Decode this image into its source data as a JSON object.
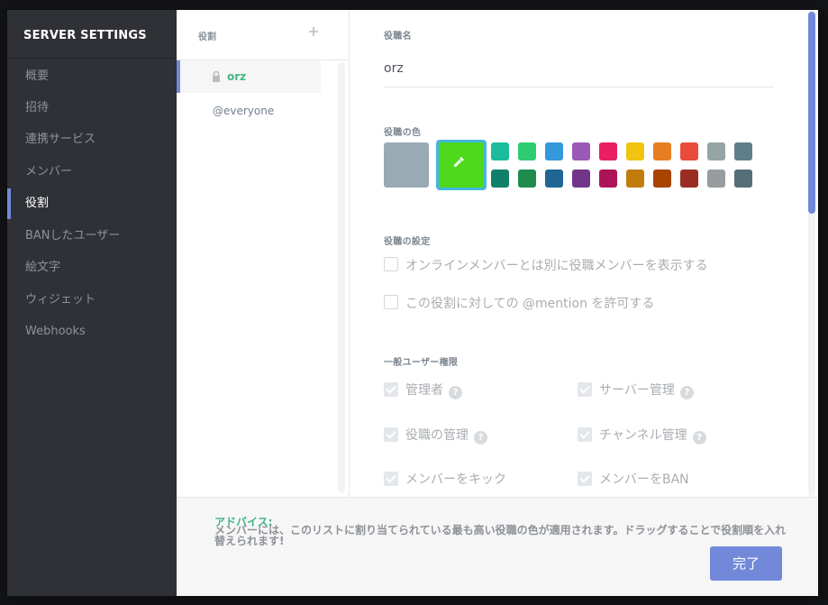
{
  "nav": {
    "title": "SERVER SETTINGS",
    "items": [
      {
        "label": "概要"
      },
      {
        "label": "招待"
      },
      {
        "label": "連携サービス"
      },
      {
        "label": "メンバー"
      },
      {
        "label": "役割"
      },
      {
        "label": "BANしたユーザー"
      },
      {
        "label": "絵文字"
      },
      {
        "label": "ウィジェット"
      },
      {
        "label": "Webhooks"
      }
    ],
    "active": "役割"
  },
  "roles": {
    "header": "役割",
    "add_icon": "plus-icon",
    "items": [
      {
        "name": "orz",
        "selected": true,
        "locked": true,
        "color": "#43b581"
      },
      {
        "name": "@everyone",
        "selected": false
      }
    ]
  },
  "editor": {
    "name_label": "役職名",
    "name_value": "orz",
    "color_label": "役職の色",
    "default_color": "#99aab5",
    "custom_color": "#4ed91c",
    "custom_color_icon": "eyedropper-icon",
    "palette_top": [
      "#1abc9c",
      "#2ecc71",
      "#3498db",
      "#9b59b6",
      "#e91e63",
      "#f1c40f",
      "#e67e22",
      "#e74c3c",
      "#95a5a6",
      "#607d8b"
    ],
    "palette_bottom": [
      "#11806a",
      "#1f8b4c",
      "#206694",
      "#71368a",
      "#ad1457",
      "#c27c0e",
      "#a84300",
      "#992d22",
      "#979c9f",
      "#546e7a"
    ],
    "settings_label": "役職の設定",
    "settings": [
      {
        "label": "オンラインメンバーとは別に役職メンバーを表示する",
        "checked": false
      },
      {
        "label": "この役割に対しての @mention を許可する",
        "checked": false
      }
    ],
    "perms_label": "一般ユーザー権限",
    "perms": [
      {
        "label": "管理者",
        "help": true
      },
      {
        "label": "サーバー管理",
        "help": true
      },
      {
        "label": "役職の管理",
        "help": true
      },
      {
        "label": "チャンネル管理",
        "help": true
      },
      {
        "label": "メンバーをキック",
        "help": false
      },
      {
        "label": "メンバーをBAN",
        "help": false
      }
    ]
  },
  "footer": {
    "tip_title": "アドバイス:",
    "tip_text": "メンバーには、このリストに割り当てられている最も高い役職の色が適用されます。ドラッグすることで役割順を入れ替えられます!",
    "done_label": "完了"
  }
}
